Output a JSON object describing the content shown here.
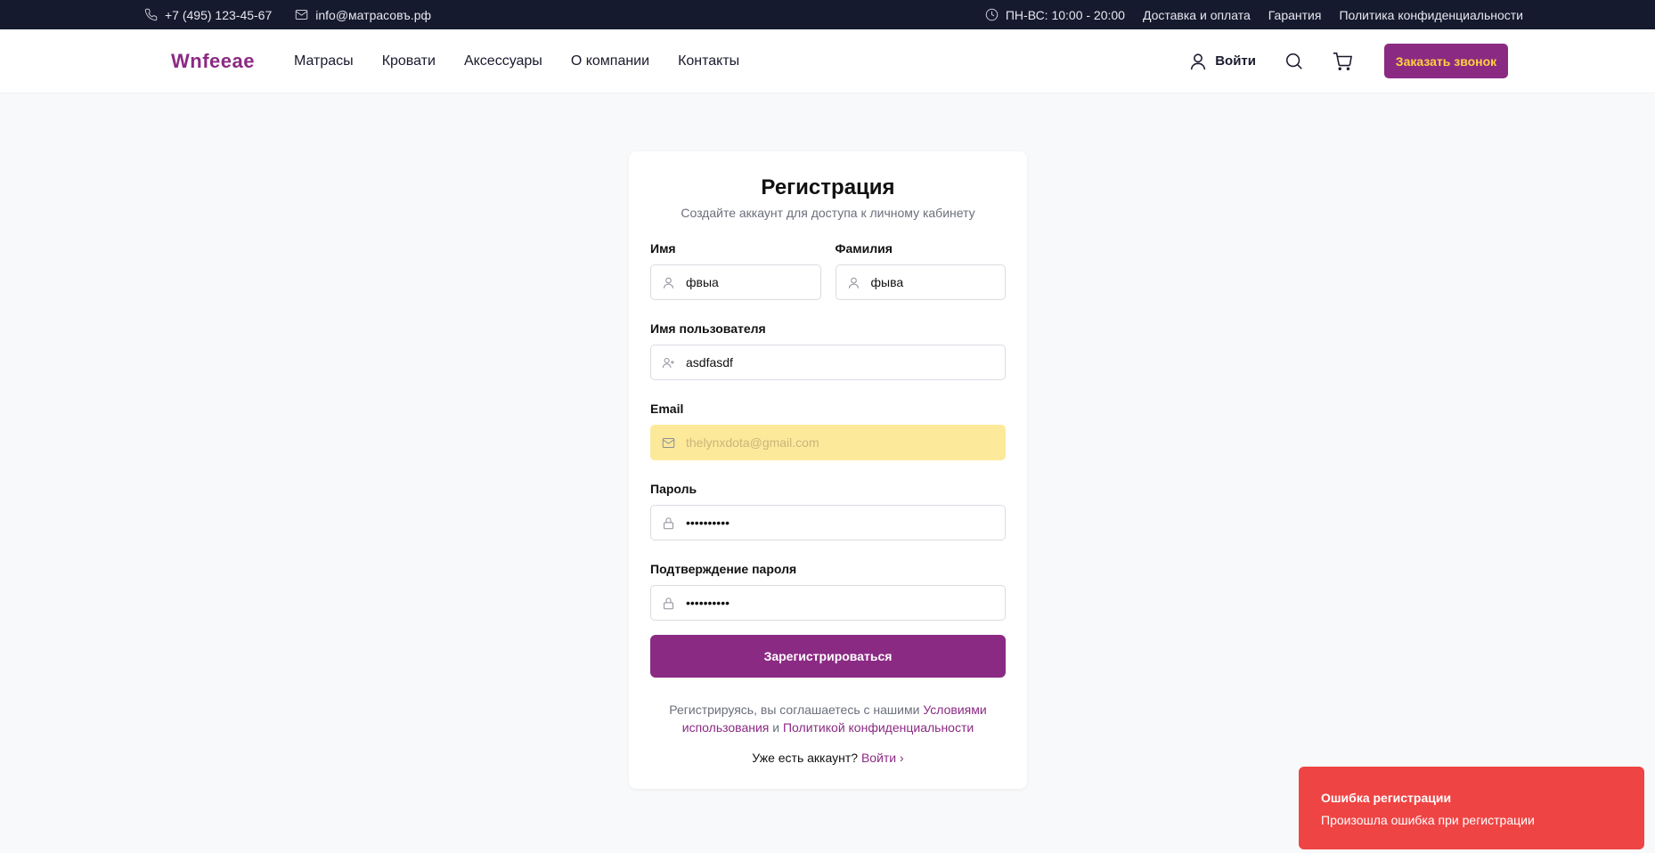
{
  "topbar": {
    "phone": "+7 (495) 123-45-67",
    "email": "info@матрасовъ.рф",
    "hours": "ПН-ВС: 10:00 - 20:00",
    "links": [
      "Доставка и оплата",
      "Гарантия",
      "Политика конфиденциальности"
    ]
  },
  "header": {
    "logo": "Wnfeeae",
    "nav": [
      "Матрасы",
      "Кровати",
      "Аксессуары",
      "О компании",
      "Контакты"
    ],
    "login_label": "Войти",
    "call_button": "Заказать звонок"
  },
  "form": {
    "title": "Регистрация",
    "subtitle": "Создайте аккаунт для доступа к личному кабинету",
    "first_name": {
      "label": "Имя",
      "value": "фвыа"
    },
    "last_name": {
      "label": "Фамилия",
      "value": "фыва"
    },
    "username": {
      "label": "Имя пользователя",
      "value": "asdfasdf"
    },
    "email": {
      "label": "Email",
      "value": "thelynxdota@gmail.com"
    },
    "password": {
      "label": "Пароль",
      "value": "••••••••••"
    },
    "password_confirm": {
      "label": "Подтверждение пароля",
      "value": "••••••••••"
    },
    "submit": "Зарегистрироваться",
    "terms_prefix": "Регистрируясь, вы соглашаетесь с нашими",
    "terms_link": "Условиями использования",
    "terms_and": "и",
    "privacy_link": "Политикой конфиденциальности",
    "already_text": "Уже есть аккаунт?",
    "login_link": "Войти",
    "login_chevron": "›"
  },
  "toast": {
    "title": "Ошибка регистрации",
    "message": "Произошла ошибка при регистрации",
    "color": "#ef4444"
  },
  "colors": {
    "brand": "#8b2a83",
    "accent": "#ffd23f",
    "topbar": "#161a2e"
  }
}
